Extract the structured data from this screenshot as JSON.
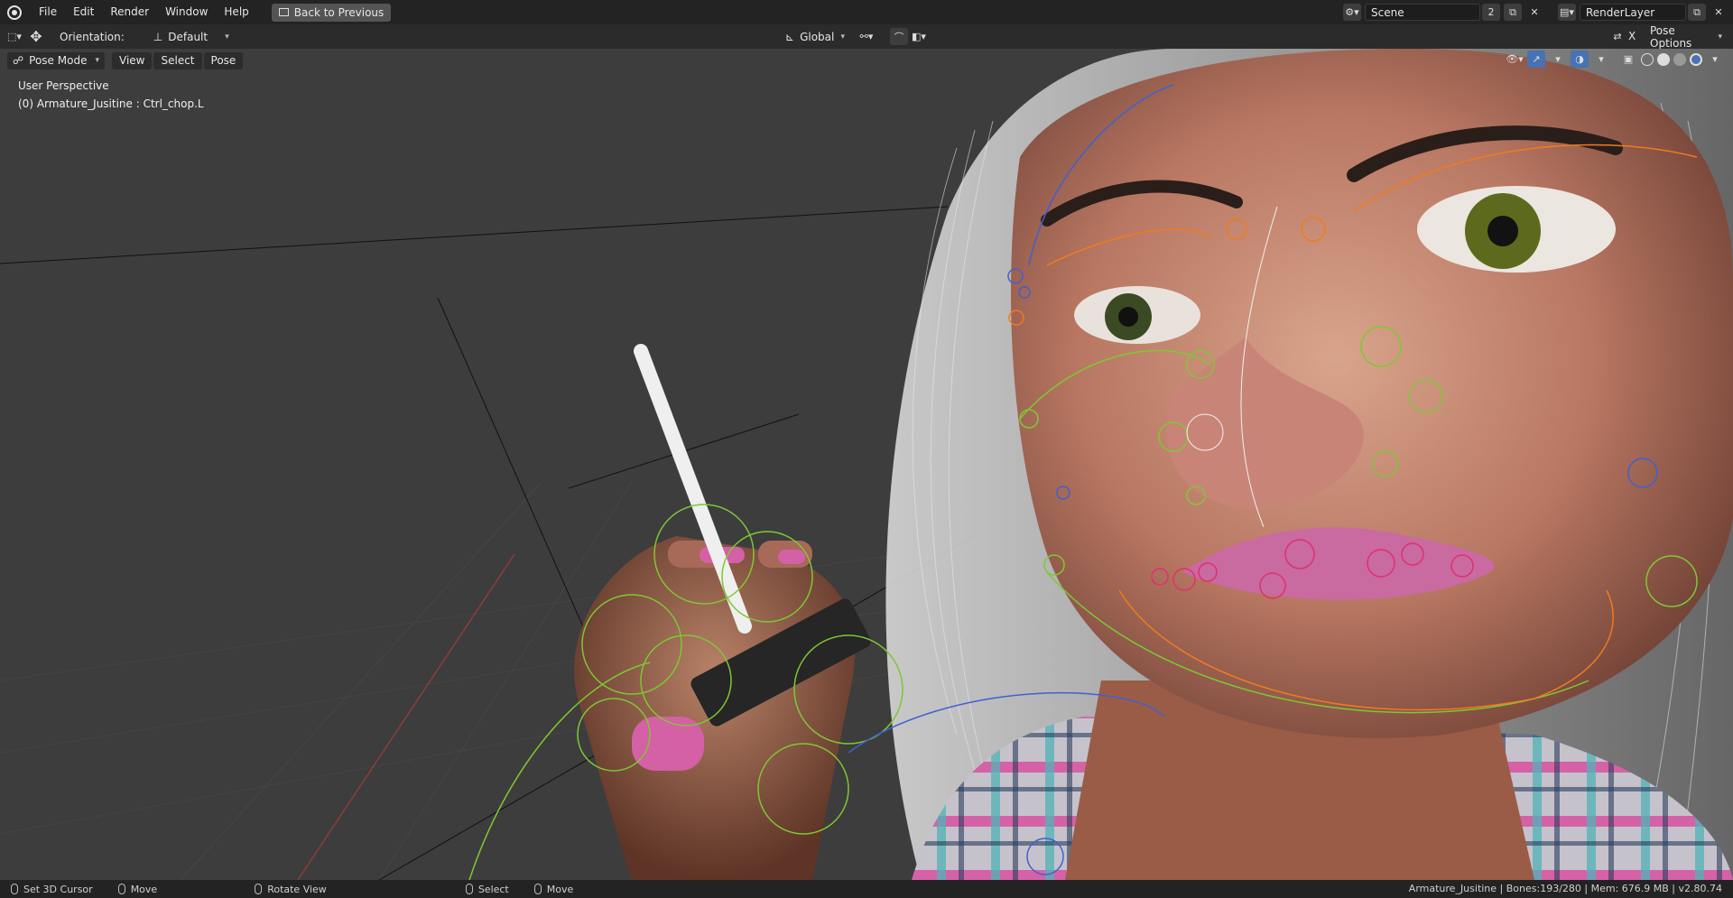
{
  "menu": {
    "items": [
      "File",
      "Edit",
      "Render",
      "Window",
      "Help"
    ],
    "back_button": "Back to Previous"
  },
  "scene": {
    "label": "Scene",
    "users": "2",
    "renderlayer": "RenderLayer"
  },
  "tool_header": {
    "orientation_label": "Orientation:",
    "orientation_value": "Default",
    "transform_space": "Global",
    "pose_options": "Pose Options",
    "x_label": "X"
  },
  "viewport_header": {
    "mode": "Pose Mode",
    "view": "View",
    "select": "Select",
    "pose": "Pose"
  },
  "viewport": {
    "perspective": "User Perspective",
    "active_object": "(0) Armature_Jusitine : Ctrl_chop.L"
  },
  "status": {
    "left": [
      {
        "action": "Set 3D Cursor"
      },
      {
        "action": "Move"
      },
      {
        "action": "Rotate View"
      },
      {
        "action": "Select"
      },
      {
        "action": "Move"
      }
    ],
    "info": "Armature_Jusitine | Bones:193/280 | Mem: 676.9 MB | v2.80.74"
  },
  "colors": {
    "accent": "#4772b3",
    "bone_green": "#7ec832",
    "bone_orange": "#f07a20",
    "bone_blue": "#4060d0",
    "bone_pink": "#e03070"
  }
}
